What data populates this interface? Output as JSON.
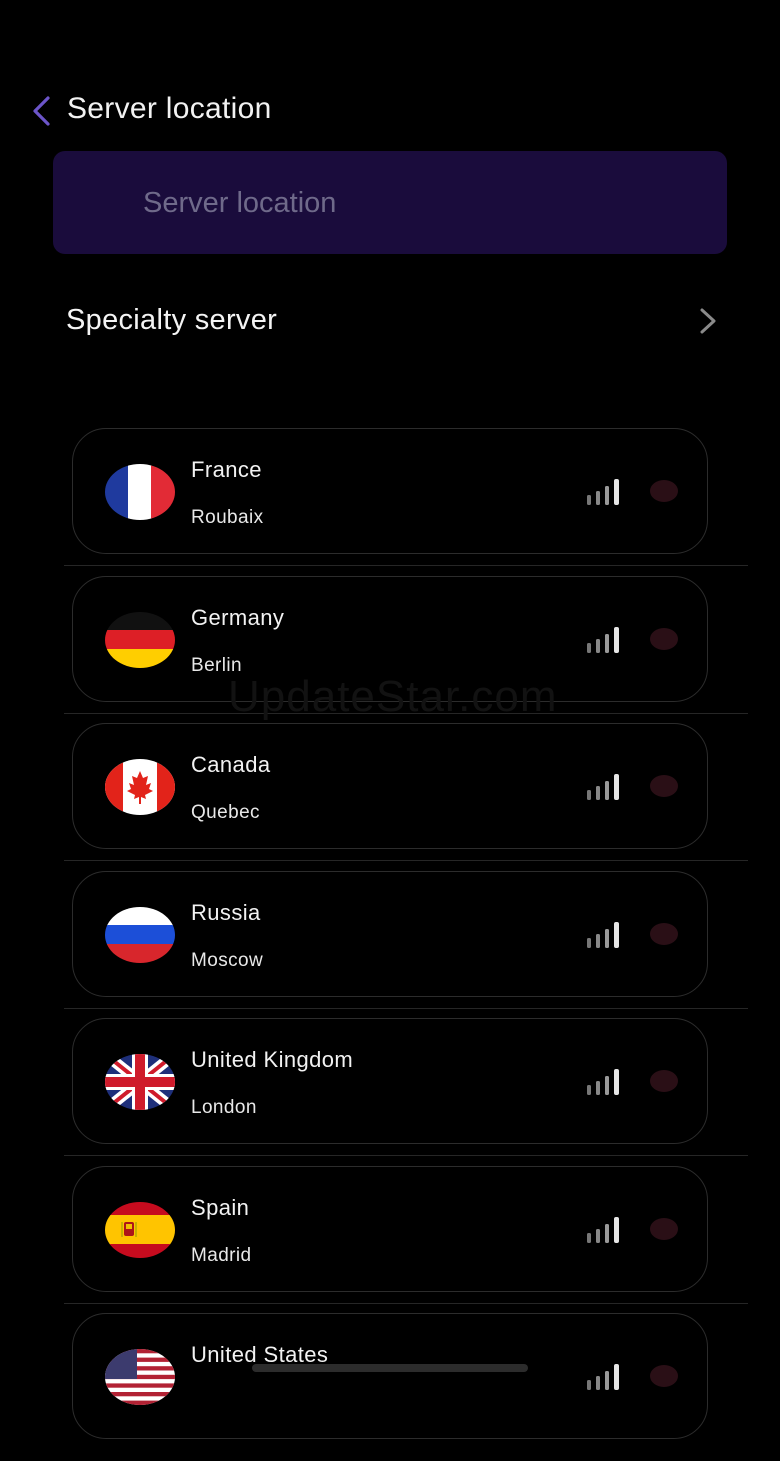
{
  "header": {
    "title": "Server location",
    "back_icon": "chevron-left-icon",
    "accent": "#6c55c9"
  },
  "search": {
    "placeholder": "Server location",
    "value": ""
  },
  "specialty": {
    "label": "Specialty server",
    "chevron_icon": "chevron-right-icon"
  },
  "servers": [
    {
      "country": "France",
      "city": "Roubaix",
      "flag": "flag-france-icon"
    },
    {
      "country": "Germany",
      "city": "Berlin",
      "flag": "flag-germany-icon"
    },
    {
      "country": "Canada",
      "city": "Quebec",
      "flag": "flag-canada-icon"
    },
    {
      "country": "Russia",
      "city": "Moscow",
      "flag": "flag-russia-icon"
    },
    {
      "country": "United Kingdom",
      "city": "London",
      "flag": "flag-uk-icon"
    },
    {
      "country": "Spain",
      "city": "Madrid",
      "flag": "flag-spain-icon"
    },
    {
      "country": "United States",
      "city": "",
      "flag": "flag-usa-icon"
    }
  ],
  "watermark": "UpdateStar.com",
  "colors": {
    "background": "#000000",
    "search_bg": "#1a0c3c",
    "select_dot": "#2a0f16"
  }
}
